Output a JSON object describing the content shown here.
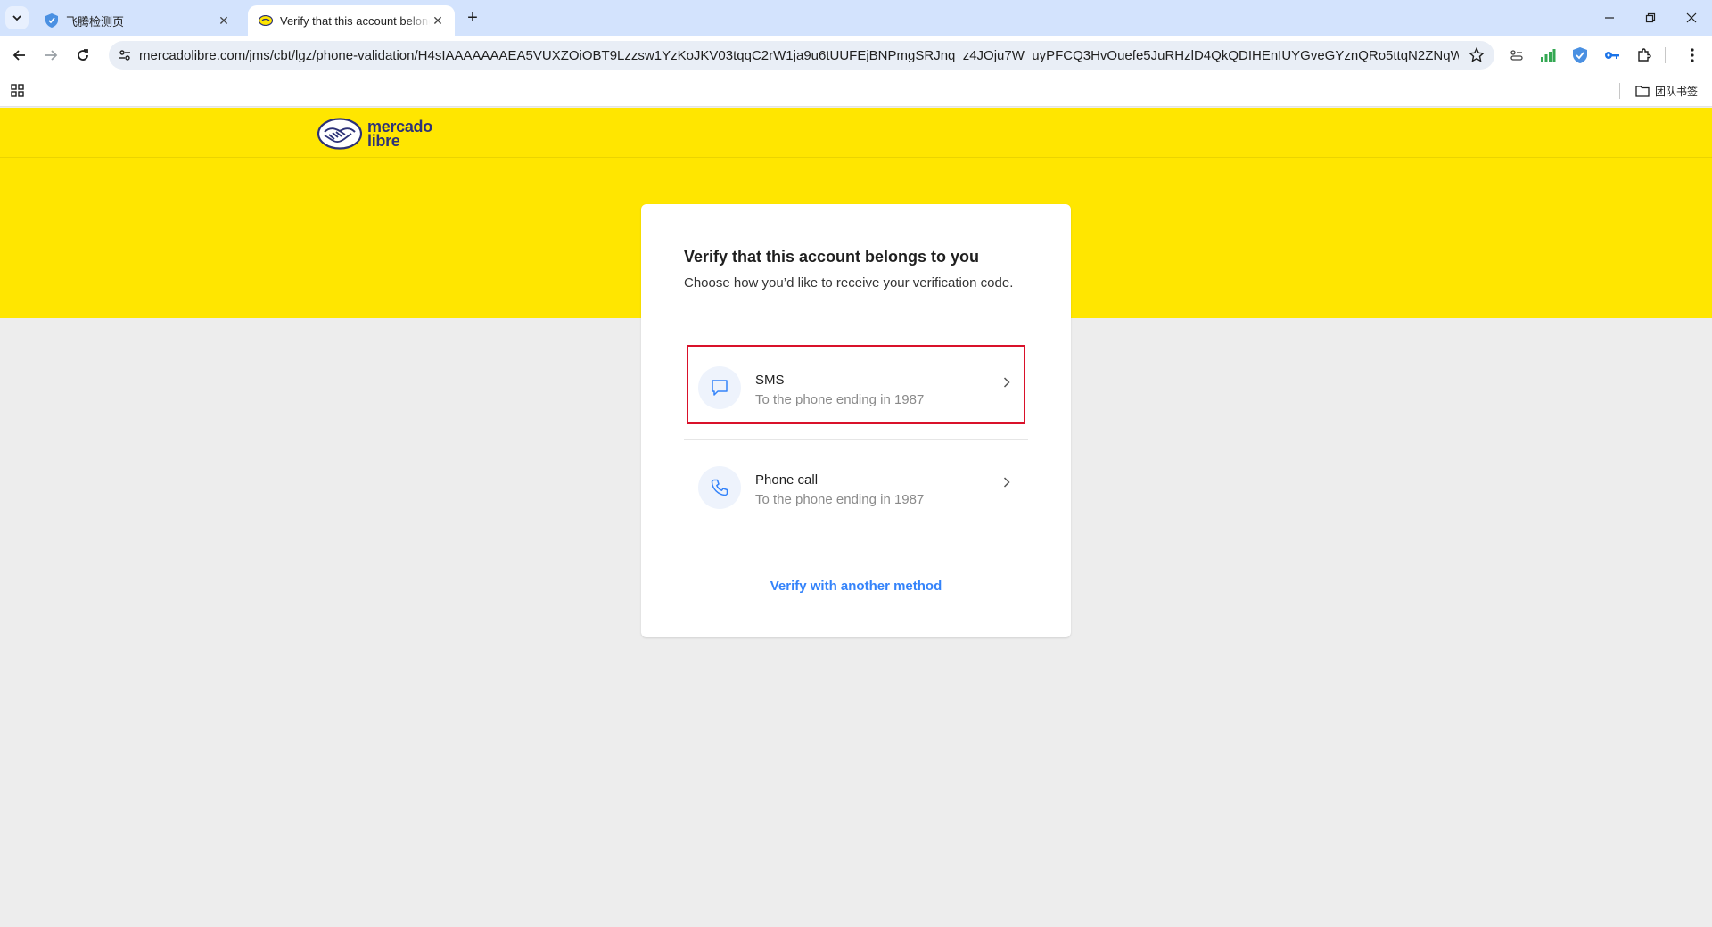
{
  "browser": {
    "tabs": [
      {
        "title": "飞腾检测页",
        "active": false,
        "favicon": "shield-favicon"
      },
      {
        "title": "Verify that this account belongs to you",
        "active": true,
        "favicon": "mercadolibre-favicon"
      }
    ],
    "new_tab_label": "+",
    "address_bar": {
      "url": "mercadolibre.com/jms/cbt/lgz/phone-validation/H4sIAAAAAAAEA5VUXZOiOBT9Lzzsw1YzKoJKV03tqqC2rW1ja9u6tUUFEjBNPmgSRJnq_z4JOju7W_uyPFCQ3HvOuefe5JuRHzlD4QkQDIHEnIUYGveGYznQRo5ttqN2ZNqWG..."
    },
    "bookmarks": {
      "folder_label": "团队书签"
    },
    "accent_color": "#d3e3fd"
  },
  "site": {
    "brand_line1": "mercado",
    "brand_line2": "libre",
    "brand_color": "#ffe600"
  },
  "card": {
    "title": "Verify that this account belongs to you",
    "subtitle": "Choose how you’d like to receive your verification code.",
    "options": [
      {
        "title": "SMS",
        "description": "To the phone ending in 1987",
        "icon": "message-icon",
        "selected": true
      },
      {
        "title": "Phone call",
        "description": "To the phone ending in 1987",
        "icon": "phone-icon",
        "selected": false
      }
    ],
    "alt_link": "Verify with another method",
    "link_color": "#3483fa",
    "highlight_color": "#d9112a"
  }
}
